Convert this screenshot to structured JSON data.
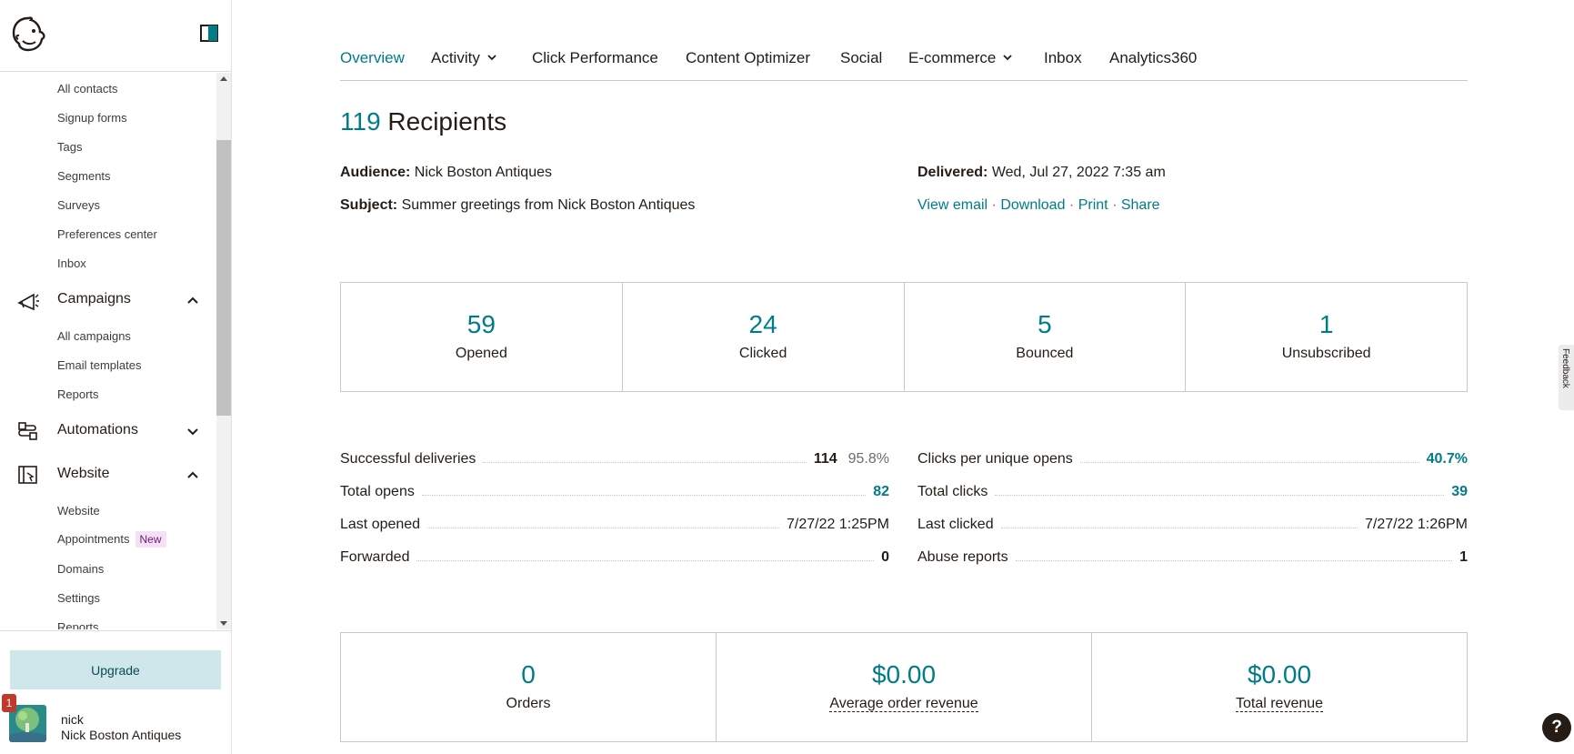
{
  "sidebar": {
    "audience_items": [
      "All contacts",
      "Signup forms",
      "Tags",
      "Segments",
      "Surveys",
      "Preferences center",
      "Inbox"
    ],
    "campaigns": {
      "label": "Campaigns",
      "items": [
        "All campaigns",
        "Email templates",
        "Reports"
      ]
    },
    "automations": {
      "label": "Automations"
    },
    "website": {
      "label": "Website",
      "items": [
        "Website",
        "Appointments",
        "Domains",
        "Settings",
        "Reports"
      ],
      "new_badge": "New"
    },
    "upgrade_label": "Upgrade",
    "notification_count": "1",
    "user": {
      "name": "nick",
      "org": "Nick Boston Antiques"
    }
  },
  "tabs": [
    {
      "label": "Overview",
      "active": true
    },
    {
      "label": "Activity",
      "dropdown": true
    },
    {
      "label": "Click Performance"
    },
    {
      "label": "Content Optimizer"
    },
    {
      "label": "Social"
    },
    {
      "label": "E-commerce",
      "dropdown": true
    },
    {
      "label": "Inbox"
    },
    {
      "label": "Analytics360"
    }
  ],
  "summary": {
    "recipients_count": "119",
    "recipients_label": "Recipients",
    "audience_label": "Audience:",
    "audience_value": "Nick Boston Antiques",
    "subject_label": "Subject:",
    "subject_value": "Summer greetings from Nick Boston Antiques",
    "delivered_label": "Delivered:",
    "delivered_value": "Wed, Jul 27, 2022 7:35 am",
    "links": {
      "view": "View email",
      "download": "Download",
      "print": "Print",
      "share": "Share",
      "sep": "·"
    }
  },
  "stats": [
    {
      "value": "59",
      "label": "Opened"
    },
    {
      "value": "24",
      "label": "Clicked"
    },
    {
      "value": "5",
      "label": "Bounced"
    },
    {
      "value": "1",
      "label": "Unsubscribed"
    }
  ],
  "details_left": [
    {
      "key": "Successful deliveries",
      "value": "114",
      "pct": "95.8%"
    },
    {
      "key": "Total opens",
      "value": "82"
    },
    {
      "key": "Last opened",
      "value": "7/27/22 1:25PM"
    },
    {
      "key": "Forwarded",
      "value": "0"
    }
  ],
  "details_right": [
    {
      "key": "Clicks per unique opens",
      "value": "40.7%"
    },
    {
      "key": "Total clicks",
      "value": "39"
    },
    {
      "key": "Last clicked",
      "value": "7/27/22 1:26PM"
    },
    {
      "key": "Abuse reports",
      "value": "1"
    }
  ],
  "ecommerce": [
    {
      "value": "0",
      "label": "Orders"
    },
    {
      "value": "$0.00",
      "label": "Average order revenue"
    },
    {
      "value": "$0.00",
      "label": "Total revenue"
    }
  ],
  "feedback_label": "Feedback",
  "help_label": "?",
  "colors": {
    "accent": "#007c89",
    "text": "#241c15",
    "upgrade_bg": "#cfe7ea",
    "badge_bg": "#f6e0f6"
  }
}
